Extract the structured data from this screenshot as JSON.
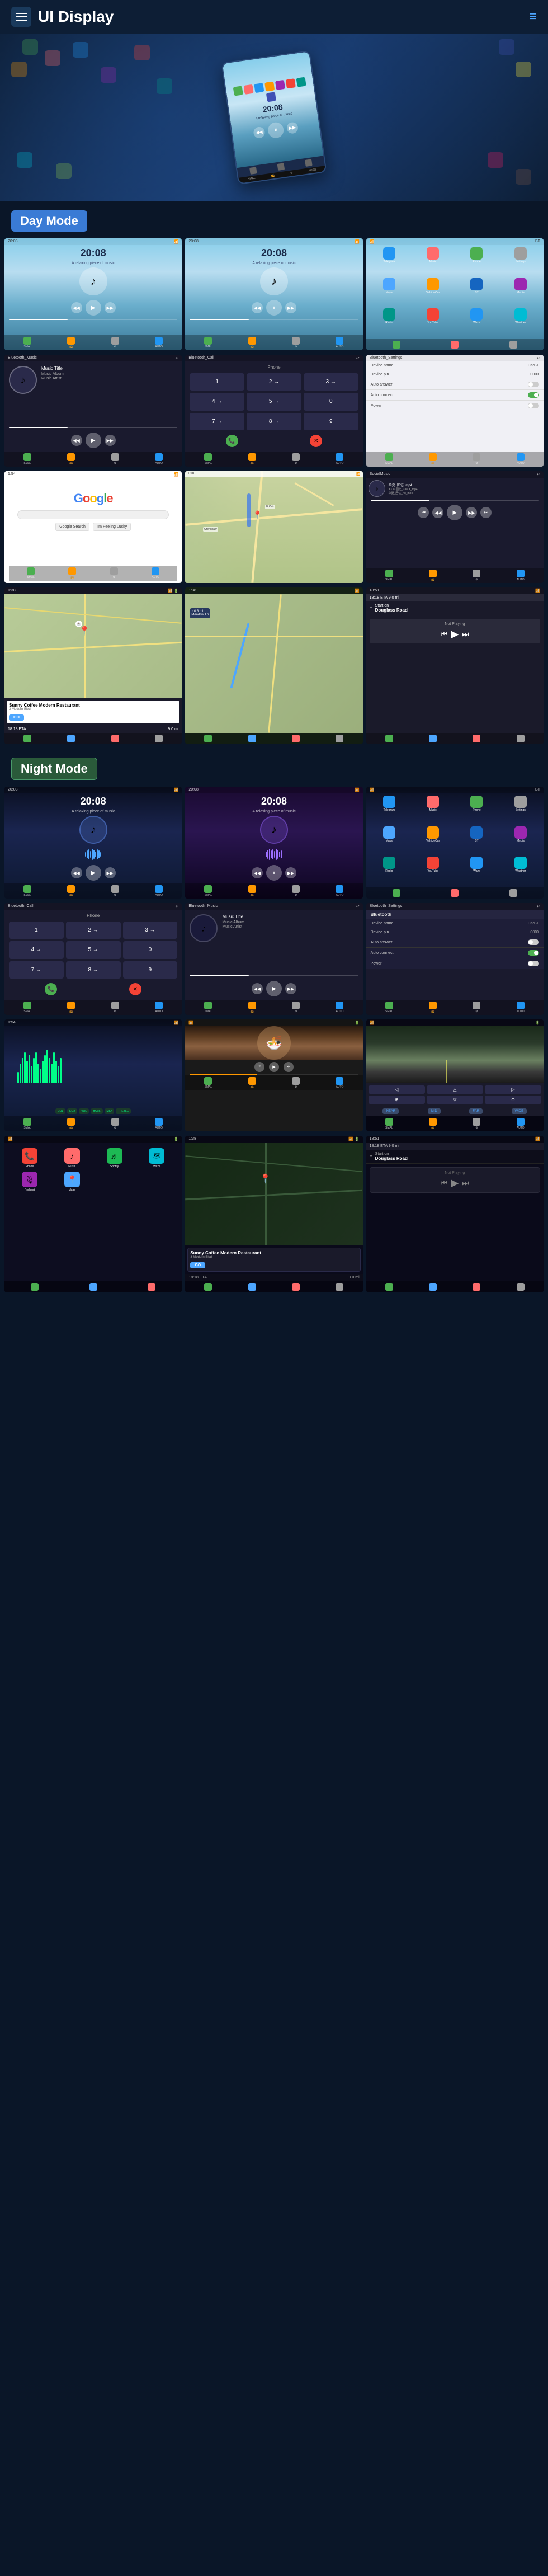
{
  "header": {
    "title": "UI Display",
    "menu_icon": "≡",
    "nav_icon": "≡"
  },
  "sections": {
    "day_mode": {
      "label": "Day Mode"
    },
    "night_mode": {
      "label": "Night Mode"
    }
  },
  "music": {
    "title": "Music Title",
    "album": "Music Album",
    "artist": "Music Artist"
  },
  "time": {
    "display": "20:08"
  },
  "settings": {
    "device_name_label": "Device name",
    "device_name_value": "CarBT",
    "device_pin_label": "Device pin",
    "device_pin_value": "0000",
    "auto_answer_label": "Auto answer",
    "auto_connect_label": "Auto connect",
    "power_label": "Power"
  },
  "destination": {
    "name": "Sunny Coffee Modern Restaurant",
    "address": "3 Modern Blvd",
    "eta_label": "18:18 ETA",
    "distance_label": "9.0 mi",
    "go": "GO"
  },
  "navigation": {
    "start_label": "Start on",
    "street": "Douglass Road",
    "not_playing": "Not Playing"
  },
  "local_music": {
    "songs": [
      "华夏_回忆_mp4",
      "XXXX回忆_XXXX_mp4",
      "华夏_回忆_rtx_mp4"
    ]
  }
}
